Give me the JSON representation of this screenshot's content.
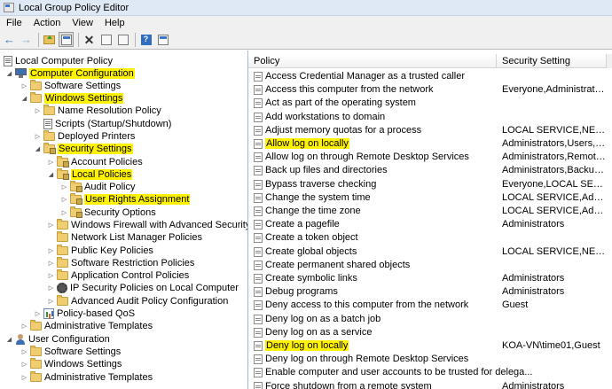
{
  "window": {
    "title": "Local Group Policy Editor"
  },
  "menu": [
    "File",
    "Action",
    "View",
    "Help"
  ],
  "toolbar": {
    "icons": [
      "back-arrow-icon",
      "forward-arrow-icon",
      "up-folder-icon",
      "show-hide-tree-icon",
      "delete-icon",
      "properties-icon",
      "export-list-icon",
      "help-icon",
      "view-icon"
    ]
  },
  "tree": {
    "root": "Local Computer Policy",
    "computer_config": "Computer Configuration",
    "software_settings": "Software Settings",
    "windows_settings": "Windows Settings",
    "name_resolution": "Name Resolution Policy",
    "scripts": "Scripts (Startup/Shutdown)",
    "deployed_printers": "Deployed Printers",
    "security_settings": "Security Settings",
    "account_policies": "Account Policies",
    "local_policies": "Local Policies",
    "audit_policy": "Audit Policy",
    "user_rights": "User Rights Assignment",
    "security_options": "Security Options",
    "firewall": "Windows Firewall with Advanced Security",
    "network_list": "Network List Manager Policies",
    "public_key": "Public Key Policies",
    "software_restriction": "Software Restriction Policies",
    "app_control": "Application Control Policies",
    "ip_security": "IP Security Policies on Local Computer",
    "adv_audit": "Advanced Audit Policy Configuration",
    "qos": "Policy-based QoS",
    "admin_templates_c": "Administrative Templates",
    "user_config": "User Configuration",
    "u_software_settings": "Software Settings",
    "u_windows_settings": "Windows Settings",
    "u_admin_templates": "Administrative Templates"
  },
  "list": {
    "columns": {
      "policy": "Policy",
      "setting": "Security Setting"
    },
    "rows": [
      {
        "policy": "Access Credential Manager as a trusted caller",
        "setting": ""
      },
      {
        "policy": "Access this computer from the network",
        "setting": "Everyone,Administrators,..."
      },
      {
        "policy": "Act as part of the operating system",
        "setting": ""
      },
      {
        "policy": "Add workstations to domain",
        "setting": ""
      },
      {
        "policy": "Adjust memory quotas for a process",
        "setting": "LOCAL SERVICE,NETWO..."
      },
      {
        "policy": "Allow log on locally",
        "setting": "Administrators,Users,Ba..."
      },
      {
        "policy": "Allow log on through Remote Desktop Services",
        "setting": "Administrators,Remote ..."
      },
      {
        "policy": "Back up files and directories",
        "setting": "Administrators,Backup ..."
      },
      {
        "policy": "Bypass traverse checking",
        "setting": "Everyone,LOCAL SERVIC..."
      },
      {
        "policy": "Change the system time",
        "setting": "LOCAL SERVICE,Admini..."
      },
      {
        "policy": "Change the time zone",
        "setting": "LOCAL SERVICE,Admini..."
      },
      {
        "policy": "Create a pagefile",
        "setting": "Administrators"
      },
      {
        "policy": "Create a token object",
        "setting": ""
      },
      {
        "policy": "Create global objects",
        "setting": "LOCAL SERVICE,NETWO..."
      },
      {
        "policy": "Create permanent shared objects",
        "setting": ""
      },
      {
        "policy": "Create symbolic links",
        "setting": "Administrators"
      },
      {
        "policy": "Debug programs",
        "setting": "Administrators"
      },
      {
        "policy": "Deny access to this computer from the network",
        "setting": "Guest"
      },
      {
        "policy": "Deny log on as a batch job",
        "setting": ""
      },
      {
        "policy": "Deny log on as a service",
        "setting": ""
      },
      {
        "policy": "Deny log on locally",
        "setting": "KOA-VN\\time01,Guest"
      },
      {
        "policy": "Deny log on through Remote Desktop Services",
        "setting": ""
      },
      {
        "policy": "Enable computer and user accounts to be trusted for delega...",
        "setting": ""
      },
      {
        "policy": "Force shutdown from a remote system",
        "setting": "Administrators"
      }
    ]
  },
  "colors": {
    "highlight": "#fff200",
    "titlebar": "#dfe9f5"
  }
}
